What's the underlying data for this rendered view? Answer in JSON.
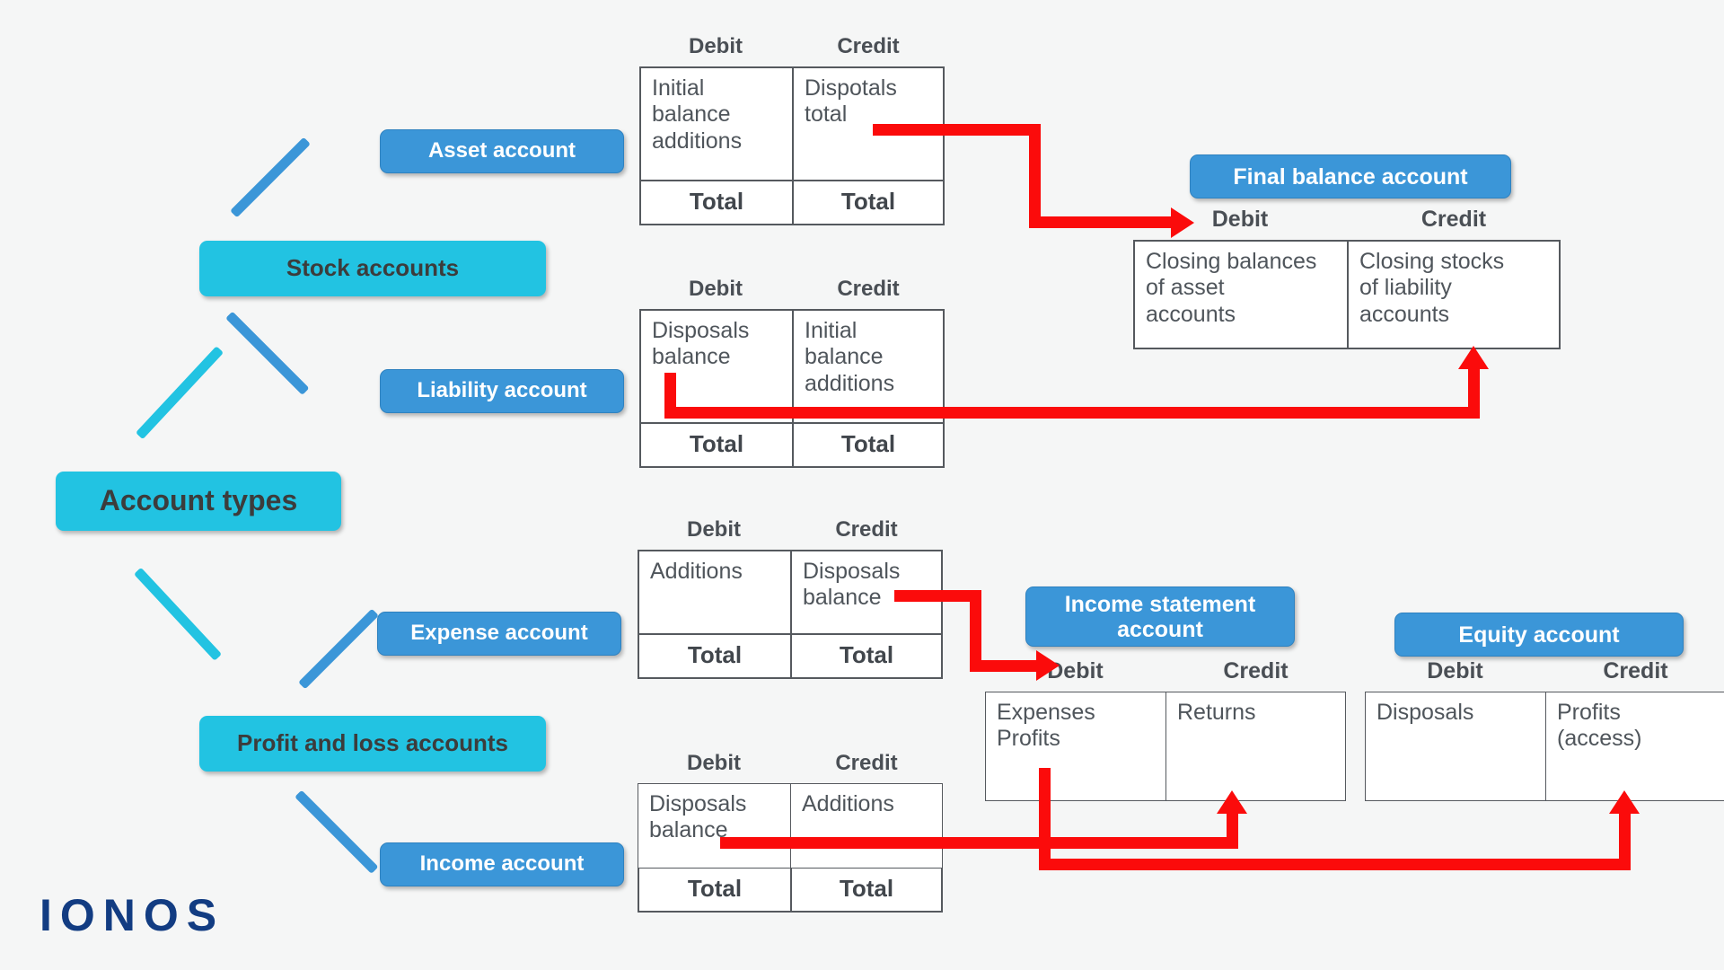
{
  "page": {
    "background": "#f5f6f6",
    "brand_logo": "IONOS",
    "brand_color": "#123c82",
    "accent_cyan": "#22c3e2",
    "accent_blue": "#3b96d8",
    "arrow_color": "#fb0b0b",
    "table_border": "#55595e",
    "body_text_color": "#4f555b"
  },
  "tree": {
    "root": {
      "label": "Account types"
    },
    "branches": [
      {
        "label": "Stock accounts"
      },
      {
        "label": "Profit and loss accounts"
      }
    ],
    "leaves": [
      {
        "label": "Asset account"
      },
      {
        "label": "Liability account"
      },
      {
        "label": "Expense account"
      },
      {
        "label": "Income account"
      }
    ]
  },
  "headers": {
    "debit": "Debit",
    "credit": "Credit",
    "total": "Total"
  },
  "accounts": [
    {
      "id": "asset-account-t",
      "title": "",
      "debit": "Initial\nbalance\nadditions",
      "credit": "Dispotals\ntotal",
      "has_totals": true
    },
    {
      "id": "liability-account-t",
      "title": "",
      "debit": "Disposals\nbalance",
      "credit": "Initial\nbalance\nadditions",
      "has_totals": true
    },
    {
      "id": "expense-account-t",
      "title": "",
      "debit": "Additions",
      "credit": "Disposals\nbalance",
      "has_totals": true
    },
    {
      "id": "income-account-t",
      "title": "",
      "debit": "Disposals\nbalance",
      "credit": "Additions",
      "has_totals": true
    },
    {
      "id": "final-balance-account-t",
      "title": "Final balance account",
      "debit": "Closing balances\nof asset\naccounts",
      "credit": "Closing stocks\nof liability\naccounts",
      "has_totals": false
    },
    {
      "id": "income-statement-account-t",
      "title": "Income statement\naccount",
      "debit": "Expenses\nProfits",
      "credit": "Returns",
      "has_totals": false
    },
    {
      "id": "equity-account-t",
      "title": "Equity account",
      "debit": "Disposals",
      "credit": "Profits\n(access)",
      "has_totals": false
    }
  ]
}
